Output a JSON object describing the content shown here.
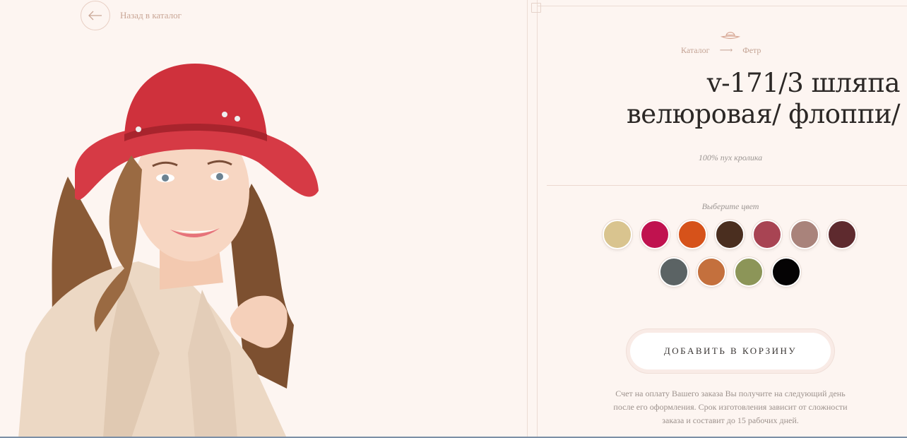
{
  "nav": {
    "back_label": "Назад в каталог"
  },
  "breadcrumb": {
    "items": [
      "Каталог",
      "Фетр"
    ],
    "separator": "⟶"
  },
  "product": {
    "title": "v-171/3 шляпа велюровая/ флоппи/",
    "composition": "100% пух кролика"
  },
  "colors": {
    "label": "Выберите цвет",
    "swatches": [
      "#d9c48f",
      "#c0124f",
      "#d6521a",
      "#4a2e1f",
      "#a84453",
      "#a9837b",
      "#5e2a2e",
      "#5b6364",
      "#c4703d",
      "#8c9558",
      "#050304"
    ]
  },
  "cart": {
    "button_label": "ДОБАВИТЬ В КОРЗИНУ"
  },
  "note": {
    "text": "Счет на оплату Вашего заказа Вы получите на следующий день после его оформления. Срок изготовления зависит от сложности заказа и составит до 15 рабочих дней."
  }
}
